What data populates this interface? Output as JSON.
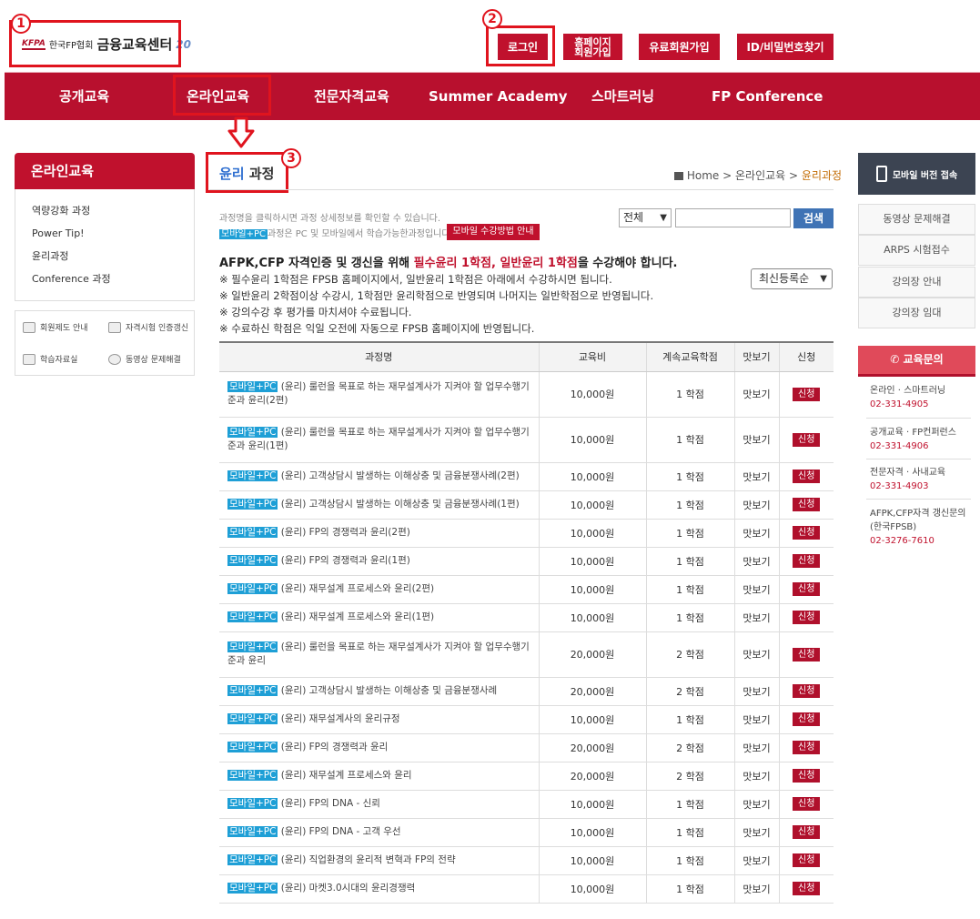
{
  "header": {
    "logo_mark": "KFPA",
    "logo_small": "한국FP협회",
    "logo_big": "금융교육센터",
    "logo_badge": "20",
    "buttons": {
      "login": "로그인",
      "home1": "홈페이지",
      "home2": "회원가입",
      "paid": "유료회원가입",
      "find": "ID/비밀번호찾기"
    }
  },
  "nav": [
    "공개교육",
    "온라인교육",
    "전문자격교육",
    "Summer Academy",
    "스마트러닝",
    "FP Conference"
  ],
  "annotations": [
    "1",
    "2",
    "3"
  ],
  "sidebar": {
    "title": "온라인교육",
    "items": [
      "역량강화 과정",
      "Power Tip!",
      "윤리과정",
      "Conference 과정"
    ],
    "quick": [
      "회원제도 안내",
      "자격시험 인증갱신",
      "학습자료실",
      "동영상 문제해결"
    ]
  },
  "content": {
    "title_a": "윤리",
    "title_b": " 과정",
    "breadcrumb": {
      "home": "Home",
      "sep": ">",
      "level1": "온라인교육",
      "current": "윤리과정"
    },
    "info1": "과정명을 클릭하시면 과정 상세정보를 확인할 수 있습니다.",
    "info2_tag": "모바일+PC",
    "info2_text": "과정은 PC 및 모바일에서 학습가능한과정입니다.",
    "mobile_guide": "모바일 수강방법 안내",
    "search_select": "전체",
    "search_button": "검색",
    "sort": "최신등록순",
    "notice_pre": "AFPK,CFP 자격인증 및 갱신을 위해 ",
    "notice_red": "필수윤리 1학점, 일반윤리 1학점",
    "notice_post": "을 수강해야 합니다.",
    "notices": [
      "※ 필수윤리 1학점은 FPSB 홈페이지에서, 일반윤리 1학점은 아래에서 수강하시면 됩니다.",
      "※ 일반윤리 2학점이상 수강시, 1학점만 윤리학점으로 반영되며 나머지는 일반학점으로 반영됩니다.",
      "※ 강의수강 후 평가를 마치셔야 수료됩니다.",
      "※ 수료하신 학점은 익일 오전에 자동으로 FPSB 홈페이지에 반영됩니다."
    ]
  },
  "table": {
    "headers": [
      "과정명",
      "교육비",
      "계속교육학점",
      "맛보기",
      "신청"
    ],
    "rows": [
      {
        "tag": "모바일+PC",
        "name": " (윤리) 룰런을 목표로 하는 재무설계사가 지켜야 할 업무수행기준과 윤리(2편)",
        "fee": "10,000원",
        "credit": "1 학점",
        "preview": "맛보기",
        "apply": "신청"
      },
      {
        "tag": "모바일+PC",
        "name": " (윤리) 룰런을 목표로 하는 재무설계사가 지켜야 할 업무수행기준과 윤리(1편)",
        "fee": "10,000원",
        "credit": "1 학점",
        "preview": "맛보기",
        "apply": "신청"
      },
      {
        "tag": "모바일+PC",
        "name": " (윤리) 고객상담시 발생하는 이해상충 및 금융분쟁사례(2편)",
        "fee": "10,000원",
        "credit": "1 학점",
        "preview": "맛보기",
        "apply": "신청"
      },
      {
        "tag": "모바일+PC",
        "name": " (윤리) 고객상담시 발생하는 이해상충 및 금융분쟁사례(1편)",
        "fee": "10,000원",
        "credit": "1 학점",
        "preview": "맛보기",
        "apply": "신청"
      },
      {
        "tag": "모바일+PC",
        "name": " (윤리) FP의 경쟁력과 윤리(2편)",
        "fee": "10,000원",
        "credit": "1 학점",
        "preview": "맛보기",
        "apply": "신청"
      },
      {
        "tag": "모바일+PC",
        "name": " (윤리) FP의 경쟁력과 윤리(1편)",
        "fee": "10,000원",
        "credit": "1 학점",
        "preview": "맛보기",
        "apply": "신청"
      },
      {
        "tag": "모바일+PC",
        "name": " (윤리) 재무설계 프로세스와 윤리(2편)",
        "fee": "10,000원",
        "credit": "1 학점",
        "preview": "맛보기",
        "apply": "신청"
      },
      {
        "tag": "모바일+PC",
        "name": " (윤리) 재무설계 프로세스와 윤리(1편)",
        "fee": "10,000원",
        "credit": "1 학점",
        "preview": "맛보기",
        "apply": "신청"
      },
      {
        "tag": "모바일+PC",
        "name": " (윤리) 룰런을 목표로 하는 재무설계사가 지켜야 할 업무수행기준과 윤리",
        "fee": "20,000원",
        "credit": "2 학점",
        "preview": "맛보기",
        "apply": "신청"
      },
      {
        "tag": "모바일+PC",
        "name": " (윤리) 고객상담시 발생하는 이해상충 및 금융분쟁사례",
        "fee": "20,000원",
        "credit": "2 학점",
        "preview": "맛보기",
        "apply": "신청"
      },
      {
        "tag": "모바일+PC",
        "name": " (윤리) 재무설계사의 윤리규정",
        "fee": "10,000원",
        "credit": "1 학점",
        "preview": "맛보기",
        "apply": "신청"
      },
      {
        "tag": "모바일+PC",
        "name": " (윤리) FP의 경쟁력과 윤리",
        "fee": "20,000원",
        "credit": "2 학점",
        "preview": "맛보기",
        "apply": "신청"
      },
      {
        "tag": "모바일+PC",
        "name": " (윤리) 재무설계 프로세스와 윤리",
        "fee": "20,000원",
        "credit": "2 학점",
        "preview": "맛보기",
        "apply": "신청"
      },
      {
        "tag": "모바일+PC",
        "name": " (윤리) FP의 DNA - 신뢰",
        "fee": "10,000원",
        "credit": "1 학점",
        "preview": "맛보기",
        "apply": "신청"
      },
      {
        "tag": "모바일+PC",
        "name": " (윤리) FP의 DNA - 고객 우선",
        "fee": "10,000원",
        "credit": "1 학점",
        "preview": "맛보기",
        "apply": "신청"
      },
      {
        "tag": "모바일+PC",
        "name": " (윤리) 직업환경의 윤리적 변혁과 FP의 전략",
        "fee": "10,000원",
        "credit": "1 학점",
        "preview": "맛보기",
        "apply": "신청"
      },
      {
        "tag": "모바일+PC",
        "name": " (윤리) 마켓3.0시대의 윤리경쟁력",
        "fee": "10,000원",
        "credit": "1 학점",
        "preview": "맛보기",
        "apply": "신청"
      }
    ]
  },
  "right": {
    "mobile": "모바일 버전 접속",
    "links": [
      "동영상 문제해결",
      "ARPS 시험접수",
      "강의장 안내",
      "강의장 임대"
    ],
    "contact_title": "교육문의",
    "contacts": [
      {
        "label": "온라인 · 스마트러닝",
        "tel": "02-331-4905"
      },
      {
        "label": "공개교육 · FP컨퍼런스",
        "tel": "02-331-4906"
      },
      {
        "label": "전문자격 · 사내교육",
        "tel": "02-331-4903"
      },
      {
        "label": "AFPK,CFP자격 갱신문의",
        "label2": "(한국FPSB)",
        "tel": "02-3276-7610"
      }
    ]
  },
  "colors": {
    "brand": "#b8102e",
    "accent_blue": "#1e9fd6",
    "annotation": "#e0141e"
  }
}
